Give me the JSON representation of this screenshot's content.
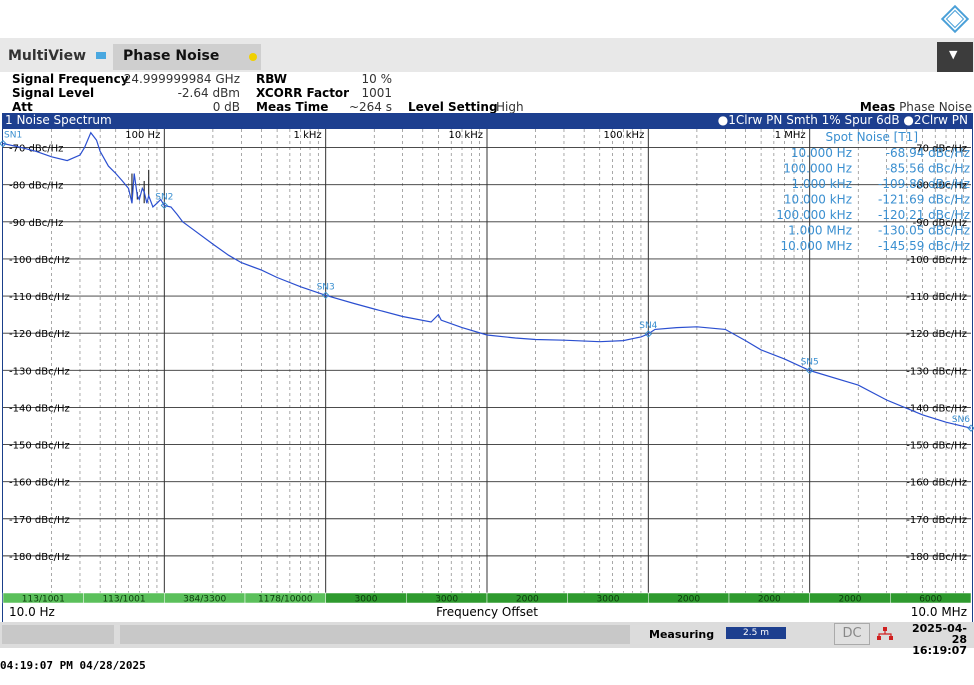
{
  "tabs": {
    "multiview": "MultiView",
    "phase_noise": "Phase Noise"
  },
  "params": {
    "signal_frequency_label": "Signal Frequency",
    "signal_frequency_value": "24.999999984 GHz",
    "signal_level_label": "Signal Level",
    "signal_level_value": "-2.64 dBm",
    "att_label": "Att",
    "att_value": "0 dB",
    "rbw_label": "RBW",
    "rbw_value": "10 %",
    "xcorr_label": "XCORR Factor",
    "xcorr_value": "1001",
    "meas_time_label": "Meas Time",
    "meas_time_value": "~264 s",
    "level_setting_label": "Level Setting",
    "level_setting_value": "High",
    "meas_label": "Meas",
    "meas_value": "Phase Noise"
  },
  "window": {
    "title": "1 Noise Spectrum",
    "trace_info_1": "1Clrw PN Smth 1% Spur 6dB",
    "trace_info_2": "2Clrw PN"
  },
  "chart_data": {
    "type": "line",
    "xscale": "log",
    "xlim": [
      10,
      10000000
    ],
    "ylim": [
      -190,
      -65
    ],
    "xlabel": "Frequency Offset",
    "x_start_label": "10.0 Hz",
    "x_stop_label": "10.0 MHz",
    "decade_labels": [
      {
        "x": 100,
        "label": "100 Hz"
      },
      {
        "x": 1000,
        "label": "1 kHz"
      },
      {
        "x": 10000,
        "label": "10 kHz"
      },
      {
        "x": 100000,
        "label": "100 kHz"
      },
      {
        "x": 1000000,
        "label": "1 MHz"
      }
    ],
    "y_ticks": [
      -70,
      -80,
      -90,
      -100,
      -110,
      -120,
      -130,
      -140,
      -150,
      -160,
      -170,
      -180
    ],
    "y_tick_labels": [
      "-70 dBc/Hz",
      "-80 dBc/Hz",
      "-90 dBc/Hz",
      "-100 dBc/Hz",
      "-110 dBc/Hz",
      "-120 dBc/Hz",
      "-130 dBc/Hz",
      "-140 dBc/Hz",
      "-150 dBc/Hz",
      "-160 dBc/Hz",
      "-170 dBc/Hz",
      "-180 dBc/Hz"
    ],
    "series": [
      {
        "x": [
          10,
          13,
          16,
          20,
          25,
          30,
          32,
          35,
          38,
          40,
          45,
          50,
          55,
          60,
          63,
          65,
          68,
          70,
          73,
          75,
          78,
          80,
          85,
          90,
          95,
          100,
          110,
          120,
          130,
          150,
          200,
          250,
          300,
          400,
          500,
          700,
          1000,
          1500,
          2000,
          3000,
          4500,
          5000,
          5200,
          7000,
          10000,
          15000,
          20000,
          30000,
          50000,
          70000,
          90000,
          100000,
          110000,
          150000,
          200000,
          300000,
          400000,
          500000,
          700000,
          1000000,
          2000000,
          3000000,
          5000000,
          7000000,
          10000000
        ],
        "y": [
          -68.9,
          -70,
          -71,
          -72.5,
          -73.5,
          -72,
          -70,
          -66,
          -68,
          -71,
          -75,
          -77,
          -79,
          -81,
          -85,
          -77,
          -83,
          -84,
          -81,
          -82,
          -85,
          -83,
          -86,
          -85,
          -84,
          -85.6,
          -86,
          -88,
          -90,
          -92,
          -96,
          -99,
          -101,
          -103,
          -105,
          -107.5,
          -109.8,
          -112,
          -113.5,
          -115.5,
          -117,
          -115,
          -116.5,
          -118.5,
          -120.5,
          -121.3,
          -121.7,
          -121.9,
          -122.3,
          -122,
          -121,
          -120.2,
          -119,
          -118.5,
          -118.3,
          -119,
          -122,
          -124.5,
          -127,
          -130.05,
          -134,
          -138,
          -142,
          -144,
          -145.6
        ]
      }
    ],
    "markers": [
      {
        "label": "SN1",
        "x": 10,
        "y": -68.94
      },
      {
        "label": "SN2",
        "x": 100,
        "y": -85.56
      },
      {
        "label": "SN3",
        "x": 1000,
        "y": -109.8
      },
      {
        "label": "SN4",
        "x": 100000,
        "y": -120.21
      },
      {
        "label": "SN5",
        "x": 1000000,
        "y": -130.05
      },
      {
        "label": "SN6",
        "x": 10000000,
        "y": -145.59
      }
    ],
    "spot_noise_title": "Spot Noise [T1]",
    "spot_noise": [
      {
        "freq": "10.000 Hz",
        "value": "-68.94 dBc/Hz"
      },
      {
        "freq": "100.000 Hz",
        "value": "-85.56 dBc/Hz"
      },
      {
        "freq": "1.000 kHz",
        "value": "-109.80 dBc/Hz"
      },
      {
        "freq": "10.000 kHz",
        "value": "-121.69 dBc/Hz"
      },
      {
        "freq": "100.000 kHz",
        "value": "-120.21 dBc/Hz"
      },
      {
        "freq": "1.000 MHz",
        "value": "-130.05 dBc/Hz"
      },
      {
        "freq": "10.000 MHz",
        "value": "-145.59 dBc/Hz"
      }
    ],
    "averaging_segments": [
      "113/1001",
      "113/1001",
      "384/3300",
      "1178/10000",
      "3000",
      "3000",
      "2000",
      "3000",
      "2000",
      "2000",
      "2000",
      "6000"
    ],
    "colors": {
      "trace": "#2b4fd0",
      "grid": "#1a1a1a",
      "marker": "#3a8fd0",
      "segment_active": "#2e9a2e",
      "segment_light": "#5bc05b"
    }
  },
  "status": {
    "measuring": "Measuring",
    "progress_text": "2.5 m",
    "dc": "DC",
    "date": "2025-04-28",
    "time": "16:19:07"
  },
  "footer": "04:19:07 PM  04/28/2025"
}
